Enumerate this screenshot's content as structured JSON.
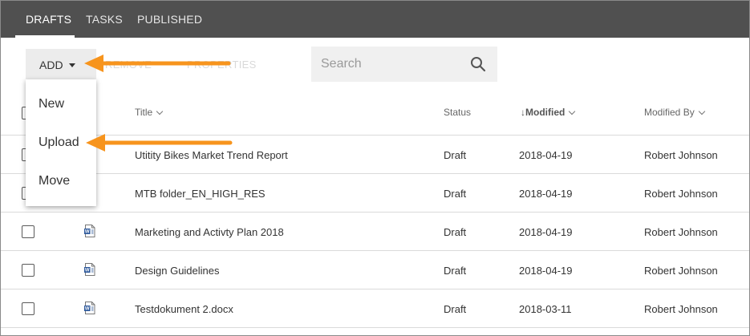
{
  "tabs": [
    {
      "label": "DRAFTS",
      "active": true
    },
    {
      "label": "TASKS",
      "active": false
    },
    {
      "label": "PUBLISHED",
      "active": false
    }
  ],
  "toolbar": {
    "add_label": "ADD",
    "ghost_remove": "REMOVE",
    "ghost_properties": "PROPERTIES"
  },
  "search": {
    "placeholder": "Search",
    "icon": "search-icon"
  },
  "menu": {
    "items": [
      "New",
      "Upload",
      "Move"
    ]
  },
  "table": {
    "columns": {
      "title": "Title",
      "status": "Status",
      "modified": "Modified",
      "modified_by": "Modified By"
    },
    "sort": {
      "column": "Modified",
      "direction": "descending"
    },
    "rows": [
      {
        "title": "Utitity Bikes Market Trend Report",
        "status": "Draft",
        "modified": "2018-04-19",
        "modified_by": "Robert Johnson",
        "icon": "word-doc-icon"
      },
      {
        "title": "MTB folder_EN_HIGH_RES",
        "status": "Draft",
        "modified": "2018-04-19",
        "modified_by": "Robert Johnson",
        "icon": "folder-icon"
      },
      {
        "title": "Marketing and Activty Plan 2018",
        "status": "Draft",
        "modified": "2018-04-19",
        "modified_by": "Robert Johnson",
        "icon": "word-doc-icon"
      },
      {
        "title": "Design Guidelines",
        "status": "Draft",
        "modified": "2018-04-19",
        "modified_by": "Robert Johnson",
        "icon": "word-doc-icon"
      },
      {
        "title": "Testdokument 2.docx",
        "status": "Draft",
        "modified": "2018-03-11",
        "modified_by": "Robert Johnson",
        "icon": "word-doc-icon"
      }
    ]
  },
  "colors": {
    "tabbar": "#505050",
    "annotation_arrow": "#f7941d",
    "word_icon": "#2b579a"
  }
}
